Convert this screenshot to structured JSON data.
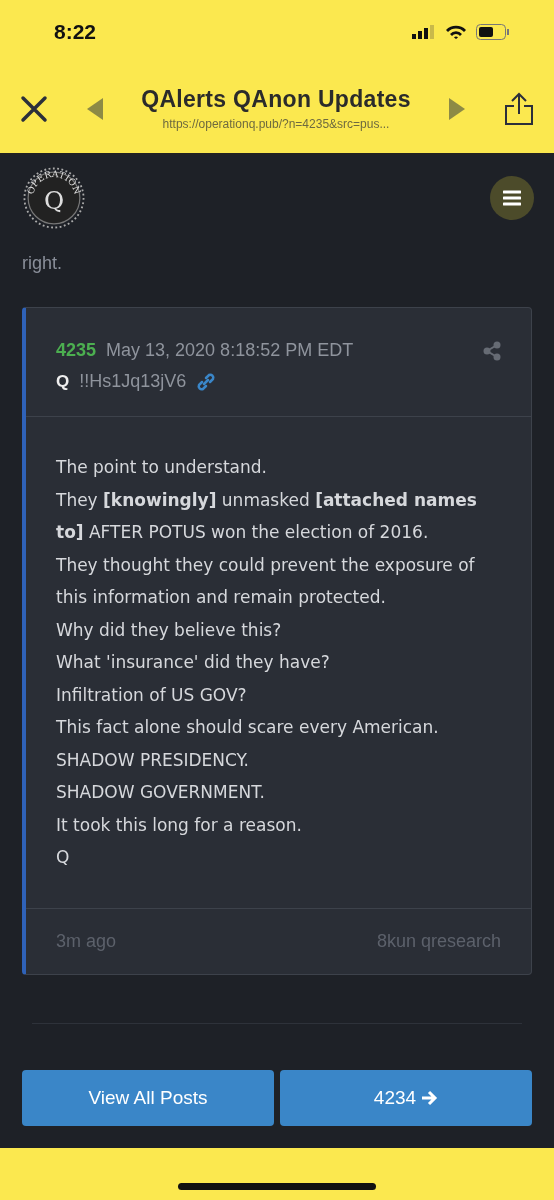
{
  "status_bar": {
    "time": "8:22"
  },
  "browser_bar": {
    "title": "QAlerts QAnon Updates",
    "url": "https://operationq.pub/?n=4235&src=pus..."
  },
  "site_header": {
    "logo": {
      "arc_text": "OPERATION",
      "letter": "Q"
    }
  },
  "intro_tail": "right.",
  "post": {
    "number": "4235",
    "date": "May 13, 2020 8:18:52 PM EDT",
    "author": "Q",
    "tripcode": "!!Hs1Jq13jV6",
    "lines": [
      "The point to understand.",
      "They **[knowingly]** unmasked **[attached names to]** AFTER POTUS won the election of 2016.",
      "They thought they could prevent the exposure of this information and remain protected.",
      "Why did they believe this?",
      "What 'insurance' did they have?",
      "Infiltration of US GOV?",
      "This fact alone should scare every American.",
      "SHADOW PRESIDENCY.",
      "SHADOW GOVERNMENT.",
      "It took this long for a reason.",
      "Q"
    ],
    "age": "3m ago",
    "source": "8kun qresearch"
  },
  "nav_buttons": [
    {
      "label": "View All Posts",
      "kind": "plain"
    },
    {
      "label": "4234",
      "kind": "next"
    }
  ]
}
